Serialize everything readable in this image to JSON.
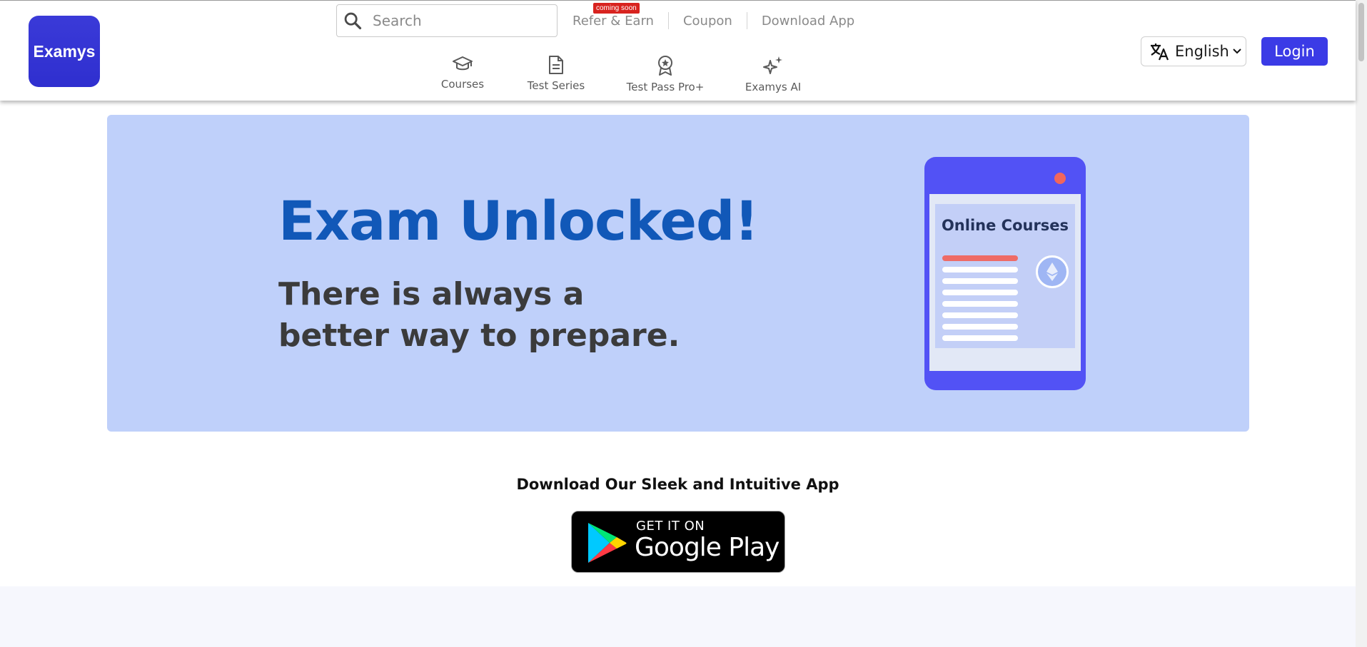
{
  "header": {
    "logo_text": "Examys",
    "search": {
      "placeholder": "Search",
      "value": ""
    },
    "top_links": [
      {
        "label": "Refer & Earn",
        "badge": "coming soon"
      },
      {
        "label": "Coupon"
      },
      {
        "label": "Download App"
      }
    ],
    "nav": [
      {
        "label": "Courses",
        "icon": "graduation-cap-icon"
      },
      {
        "label": "Test Series",
        "icon": "document-icon"
      },
      {
        "label": "Test Pass Pro+",
        "icon": "award-badge-icon"
      },
      {
        "label": "Examys AI",
        "icon": "sparkles-icon"
      }
    ],
    "language": {
      "icon": "translate-icon",
      "selected": "English"
    },
    "login_label": "Login"
  },
  "banner": {
    "headline": "Exam Unlocked!",
    "sub_line1": "There is always a",
    "sub_line2": "better way to prepare.",
    "tablet_title": "Online Courses"
  },
  "download": {
    "title": "Download Our Sleek and Intuitive App",
    "store_small": "GET IT ON",
    "store_big": "Google Play"
  },
  "colors": {
    "brand": "#3b3be6",
    "banner_bg": "#bfd0fa",
    "headline": "#1158b8",
    "badge": "#d8231f"
  }
}
